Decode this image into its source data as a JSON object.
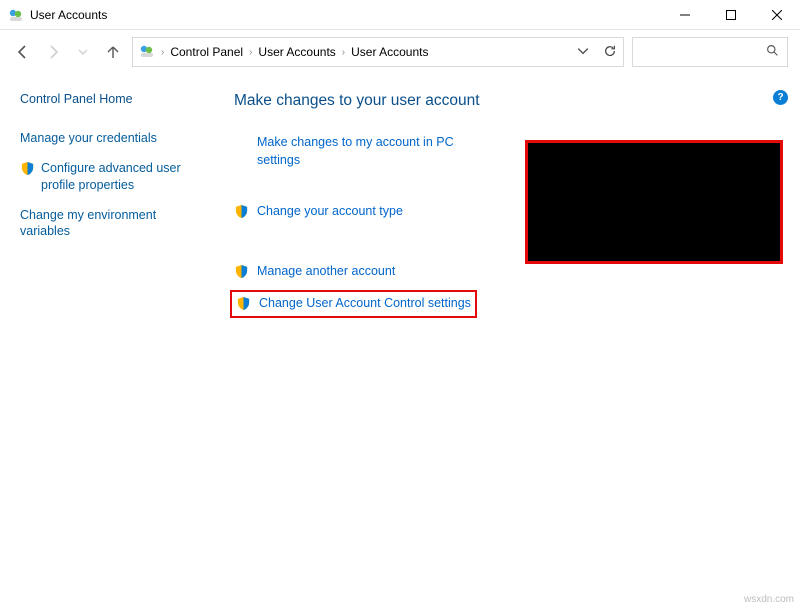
{
  "window": {
    "title": "User Accounts"
  },
  "breadcrumb": {
    "a": "Control Panel",
    "b": "User Accounts",
    "c": "User Accounts"
  },
  "sidebar": {
    "home": "Control Panel Home",
    "items": [
      {
        "label": "Manage your credentials",
        "shield": false
      },
      {
        "label": "Configure advanced user profile properties",
        "shield": true
      },
      {
        "label": "Change my environment variables",
        "shield": false
      }
    ]
  },
  "main": {
    "heading": "Make changes to your user account",
    "options": [
      {
        "label": "Make changes to my account in PC settings",
        "shield": false
      },
      {
        "label": "Change your account type",
        "shield": true
      },
      {
        "label": "Manage another account",
        "shield": true
      },
      {
        "label": "Change User Account Control settings",
        "shield": true
      }
    ]
  },
  "help": "?",
  "watermark": "wsxdn.com"
}
